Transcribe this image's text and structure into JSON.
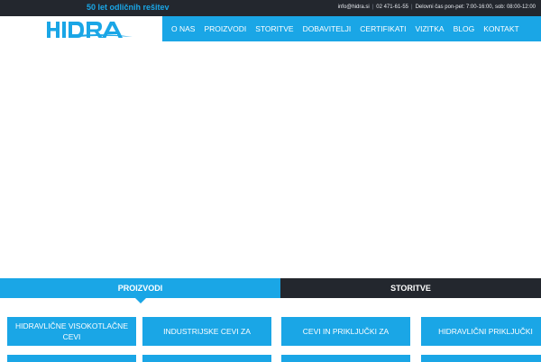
{
  "topbar": {
    "tagline": "50 let odličnih rešitev",
    "email": "info@hidra.si",
    "phone": "02 471-61-55",
    "hours": "Delovni čas pon-pet: 7:00-16:00, sob: 08:00-12:00"
  },
  "logo": {
    "text": "HIDRA"
  },
  "nav": {
    "items": [
      "O NAS",
      "PROIZVODI",
      "STORITVE",
      "DOBAVITELJI",
      "CERTIFIKATI",
      "VIZITKA",
      "BLOG",
      "KONTAKT"
    ]
  },
  "tabs": {
    "active": "PROIZVODI",
    "inactive": "STORITVE"
  },
  "cards": [
    "HIDRAVLIČNE VISOKOTLAČNE CEVI",
    "INDUSTRIJSKE CEVI ZA",
    "CEVI IN PRIKLJUČKI ZA",
    "HIDRAVLIČNI PRIKLJUČKI"
  ],
  "colors": {
    "accent": "#1aa6e6",
    "dark": "#23272e",
    "white": "#ffffff"
  }
}
